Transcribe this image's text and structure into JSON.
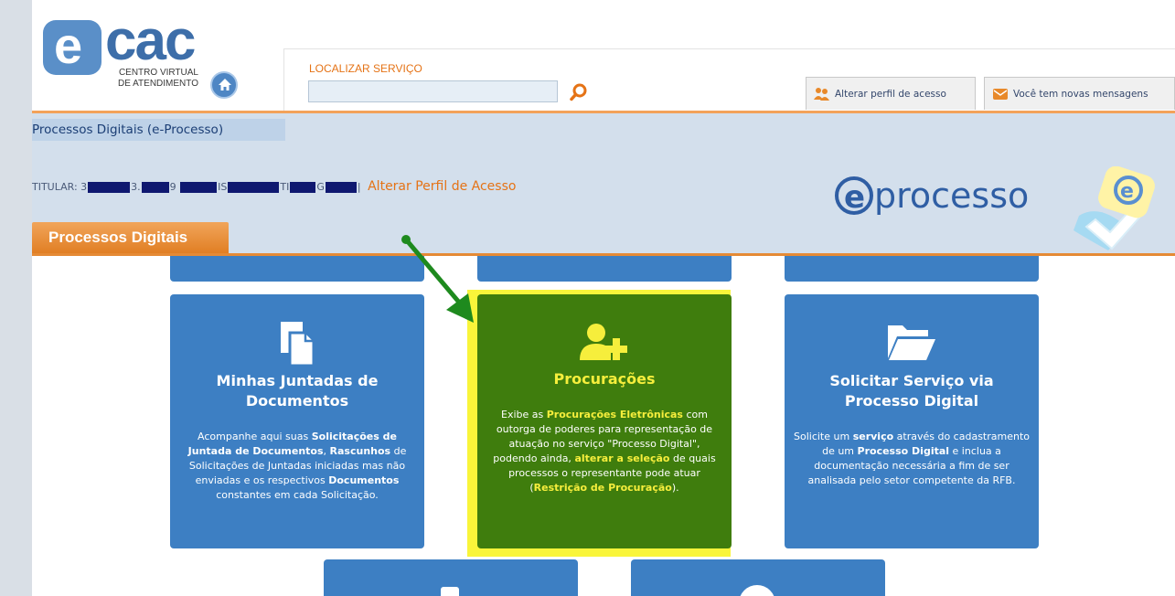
{
  "header": {
    "logo_main": "cac",
    "logo_e": "e",
    "logo_subtitle_line1": "CENTRO VIRTUAL",
    "logo_subtitle_line2": "DE ATENDIMENTO",
    "search_label": "LOCALIZAR SERVIÇO",
    "search_value": "",
    "btn_perfil": "Alterar perfil de acesso",
    "btn_mensagens": "Você tem novas mensagens"
  },
  "breadcrumb": {
    "current": "Processos Digitais (e-Processo)"
  },
  "titular": {
    "label": "TITULAR: 3",
    "frag1": "3.",
    "frag2": "9",
    "frag3": "IS",
    "frag4": "TI",
    "frag5": "G",
    "separator": "|",
    "link": "Alterar Perfil de Acesso"
  },
  "eprocesso_logo": {
    "e": "e",
    "text": "processo"
  },
  "section": {
    "title": "Processos Digitais"
  },
  "cards": [
    {
      "title": "Minhas Juntadas de Documentos",
      "icon": "document-icon",
      "desc_parts": [
        "Acompanhe aqui suas ",
        "Solicitações de Juntada de Documentos",
        ", ",
        "Rascunhos",
        " de Solicitações de Juntadas iniciadas mas não enviadas e os respectivos ",
        "Documentos",
        " constantes em cada Solicitação."
      ]
    },
    {
      "title": "Procurações",
      "icon": "add-user-icon",
      "desc_parts": [
        "Exibe as ",
        "Procurações Eletrônicas",
        " com outorga de poderes para representação de atuação no serviço \"Processo Digital\", podendo ainda, ",
        "alterar a seleção",
        " de quais processos o representante pode atuar (",
        "Restrição de Procuração",
        ")."
      ]
    },
    {
      "title": "Solicitar Serviço via Processo Digital",
      "icon": "folder-open-icon",
      "desc_parts": [
        "Solicite um ",
        "serviço",
        " através do cadastramento de um ",
        "Processo Digital",
        " e inclua a documentação necessária a fim de ser analisada pelo setor competente da RFB."
      ]
    }
  ],
  "colors": {
    "card_blue": "#3d7fc3",
    "card_green": "#3f7d0d",
    "highlight_yellow": "#f9f53a",
    "accent_orange": "#e57316",
    "arrow_green": "#1e8a1e"
  }
}
